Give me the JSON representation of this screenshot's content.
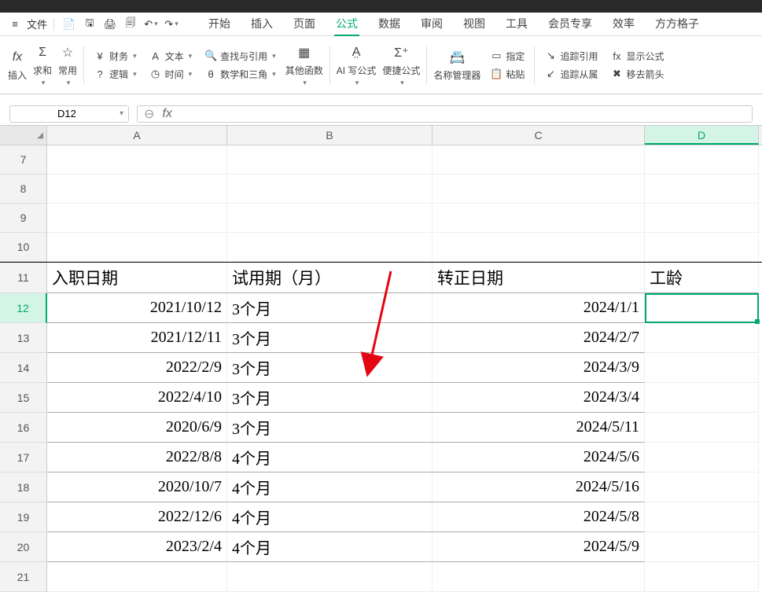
{
  "menus": {
    "file": "文件",
    "start": "开始",
    "insert": "插入",
    "page": "页面",
    "formula": "公式",
    "data": "数据",
    "review": "审阅",
    "view": "视图",
    "tools": "工具",
    "vip": "会员专享",
    "efficiency": "效率",
    "squareGrid": "方方格子"
  },
  "ribbon": {
    "fx": "fx",
    "insert": "插入",
    "sum": "Σ",
    "sumLabel": "求和",
    "star": "☆",
    "commonLabel": "常用",
    "finance": "财务",
    "text": "文本",
    "lookup": "查找与引用",
    "logic": "逻辑",
    "time": "时间",
    "math": "数学和三角",
    "otherFn": "其他函数",
    "aiWrite": "AI 写公式",
    "quickFn": "便捷公式",
    "nameMgr": "名称管理器",
    "specify": "指定",
    "paste": "粘贴",
    "traceRef": "追踪引用",
    "traceDep": "追踪从属",
    "showFx": "显示公式",
    "removeArrow": "移去箭头"
  },
  "nameBox": "D12",
  "table": {
    "headers": {
      "a": "入职日期",
      "b": "试用期（月）",
      "c": "转正日期",
      "d": "工龄"
    },
    "rows": [
      {
        "a": "2021/10/12",
        "b": "3个月",
        "c": "2024/1/1"
      },
      {
        "a": "2021/12/11",
        "b": "3个月",
        "c": "2024/2/7"
      },
      {
        "a": "2022/2/9",
        "b": "3个月",
        "c": "2024/3/9"
      },
      {
        "a": "2022/4/10",
        "b": "3个月",
        "c": "2024/3/4"
      },
      {
        "a": "2020/6/9",
        "b": "3个月",
        "c": "2024/5/11"
      },
      {
        "a": "2022/8/8",
        "b": "4个月",
        "c": "2024/5/6"
      },
      {
        "a": "2020/10/7",
        "b": "4个月",
        "c": "2024/5/16"
      },
      {
        "a": "2022/12/6",
        "b": "4个月",
        "c": "2024/5/8"
      },
      {
        "a": "2023/2/4",
        "b": "4个月",
        "c": "2024/5/9"
      }
    ]
  },
  "colLabels": {
    "a": "A",
    "b": "B",
    "c": "C",
    "d": "D"
  },
  "rowNumbers": [
    "7",
    "8",
    "9",
    "10",
    "11",
    "12",
    "13",
    "14",
    "15",
    "16",
    "17",
    "18",
    "19",
    "20",
    "21"
  ]
}
